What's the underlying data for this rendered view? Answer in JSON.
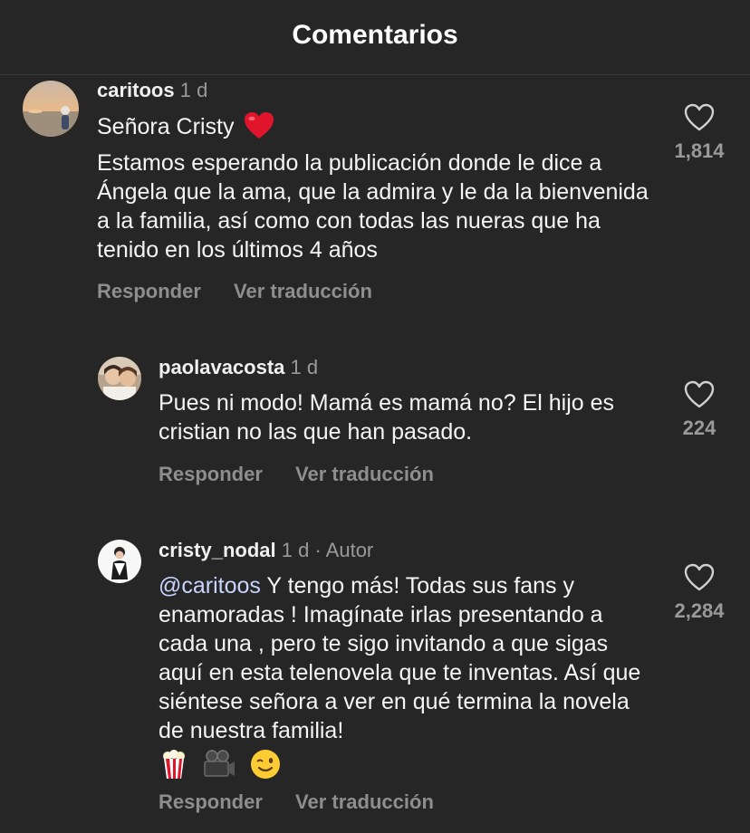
{
  "header": {
    "title": "Comentarios"
  },
  "comments": [
    {
      "username": "caritoos",
      "time": "1 d",
      "title_line": "Señora Cristy",
      "title_emoji": "heart-emoji",
      "body": "Estamos esperando la publicación donde le dice a Ángela que la ama, que la admira y le da la bienvenida a la familia, así como con todas las nueras que ha tenido en los últimos 4 años",
      "likes": "1,814",
      "reply_label": "Responder",
      "translate_label": "Ver traducción"
    },
    {
      "username": "paolavacosta",
      "time": "1 d",
      "body": "Pues ni modo! Mamá es mamá no?  El hijo es cristian no las que han pasado.",
      "likes": "224",
      "reply_label": "Responder",
      "translate_label": "Ver traducción"
    },
    {
      "username": "cristy_nodal",
      "time": "1 d",
      "author_tag": "· Autor",
      "mention": "@caritoos",
      "body": " Y tengo más! Todas sus fans y enamoradas ! Imagínate irlas presentando a cada una , pero te sigo invitando a que sigas aquí en esta telenovela que te inventas. Así que siéntese señora a ver en qué termina la novela de nuestra familia!",
      "emojis": [
        "popcorn-emoji",
        "movie-camera-emoji",
        "winking-face-emoji"
      ],
      "likes": "2,284",
      "reply_label": "Responder",
      "translate_label": "Ver traducción"
    }
  ],
  "colors": {
    "background": "#262626",
    "text": "#f5f5f5",
    "muted": "#8e8e8e",
    "mention": "#c8d4ff",
    "heart_red": "#e0142a"
  }
}
